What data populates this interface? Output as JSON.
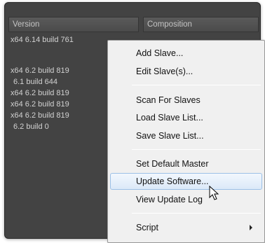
{
  "headers": {
    "version": "Version",
    "composition": "Composition"
  },
  "versions": [
    "x64 6.14 build 761",
    "x64 6.2 build 819",
    "6.1 build 644",
    "x64 6.2 build 819",
    "x64 6.2 build 819",
    "x64 6.2 build 819",
    "6.2 build 0"
  ],
  "menu": {
    "add_slave": "Add Slave...",
    "edit_slaves": "Edit Slave(s)...",
    "scan_for_slaves": "Scan For Slaves",
    "load_slave_list": "Load Slave List...",
    "save_slave_list": "Save Slave List...",
    "set_default_master": "Set Default Master",
    "update_software": "Update Software...",
    "view_update_log": "View Update Log",
    "script": "Script"
  },
  "colors": {
    "panel_bg": "#434343",
    "menu_bg": "#f0f0f0",
    "hover_bg": "#dbe9f8",
    "hover_border": "#9cc0e6"
  }
}
